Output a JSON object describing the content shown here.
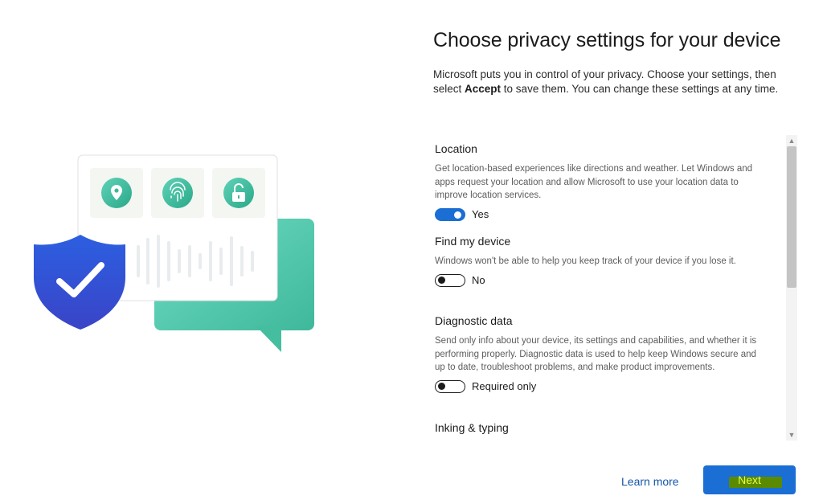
{
  "page": {
    "title": "Choose privacy settings for your device",
    "intro_before": "Microsoft puts you in control of your privacy. Choose your settings, then select ",
    "intro_bold": "Accept",
    "intro_after": " to save them. You can change these settings at any time."
  },
  "settings": [
    {
      "title": "Location",
      "description": "Get location-based experiences like directions and weather. Let Windows and apps request your location and allow Microsoft to use your location data to improve location services.",
      "state": "on",
      "state_label": "Yes"
    },
    {
      "title": "Find my device",
      "description": "Windows won't be able to help you keep track of your device if you lose it.",
      "state": "off",
      "state_label": "No"
    },
    {
      "title": "Diagnostic data",
      "description": "Send only info about your device, its settings and capabilities, and whether it is performing properly. Diagnostic data is used to help keep Windows secure and up to date, troubleshoot problems, and make product improvements.",
      "state": "off",
      "state_label": "Required only"
    },
    {
      "title": "Inking & typing"
    }
  ],
  "footer": {
    "learn_more": "Learn more",
    "next": "Next"
  },
  "colors": {
    "accent": "#1a6ed4",
    "link": "#1457a8",
    "shield": "#2f5bd6",
    "teal": "#4cc7a8"
  },
  "icons": [
    "location-pin-icon",
    "fingerprint-icon",
    "unlock-icon",
    "shield-check-icon",
    "chat-bubble-icon",
    "scroll-up-icon",
    "scroll-down-icon"
  ]
}
